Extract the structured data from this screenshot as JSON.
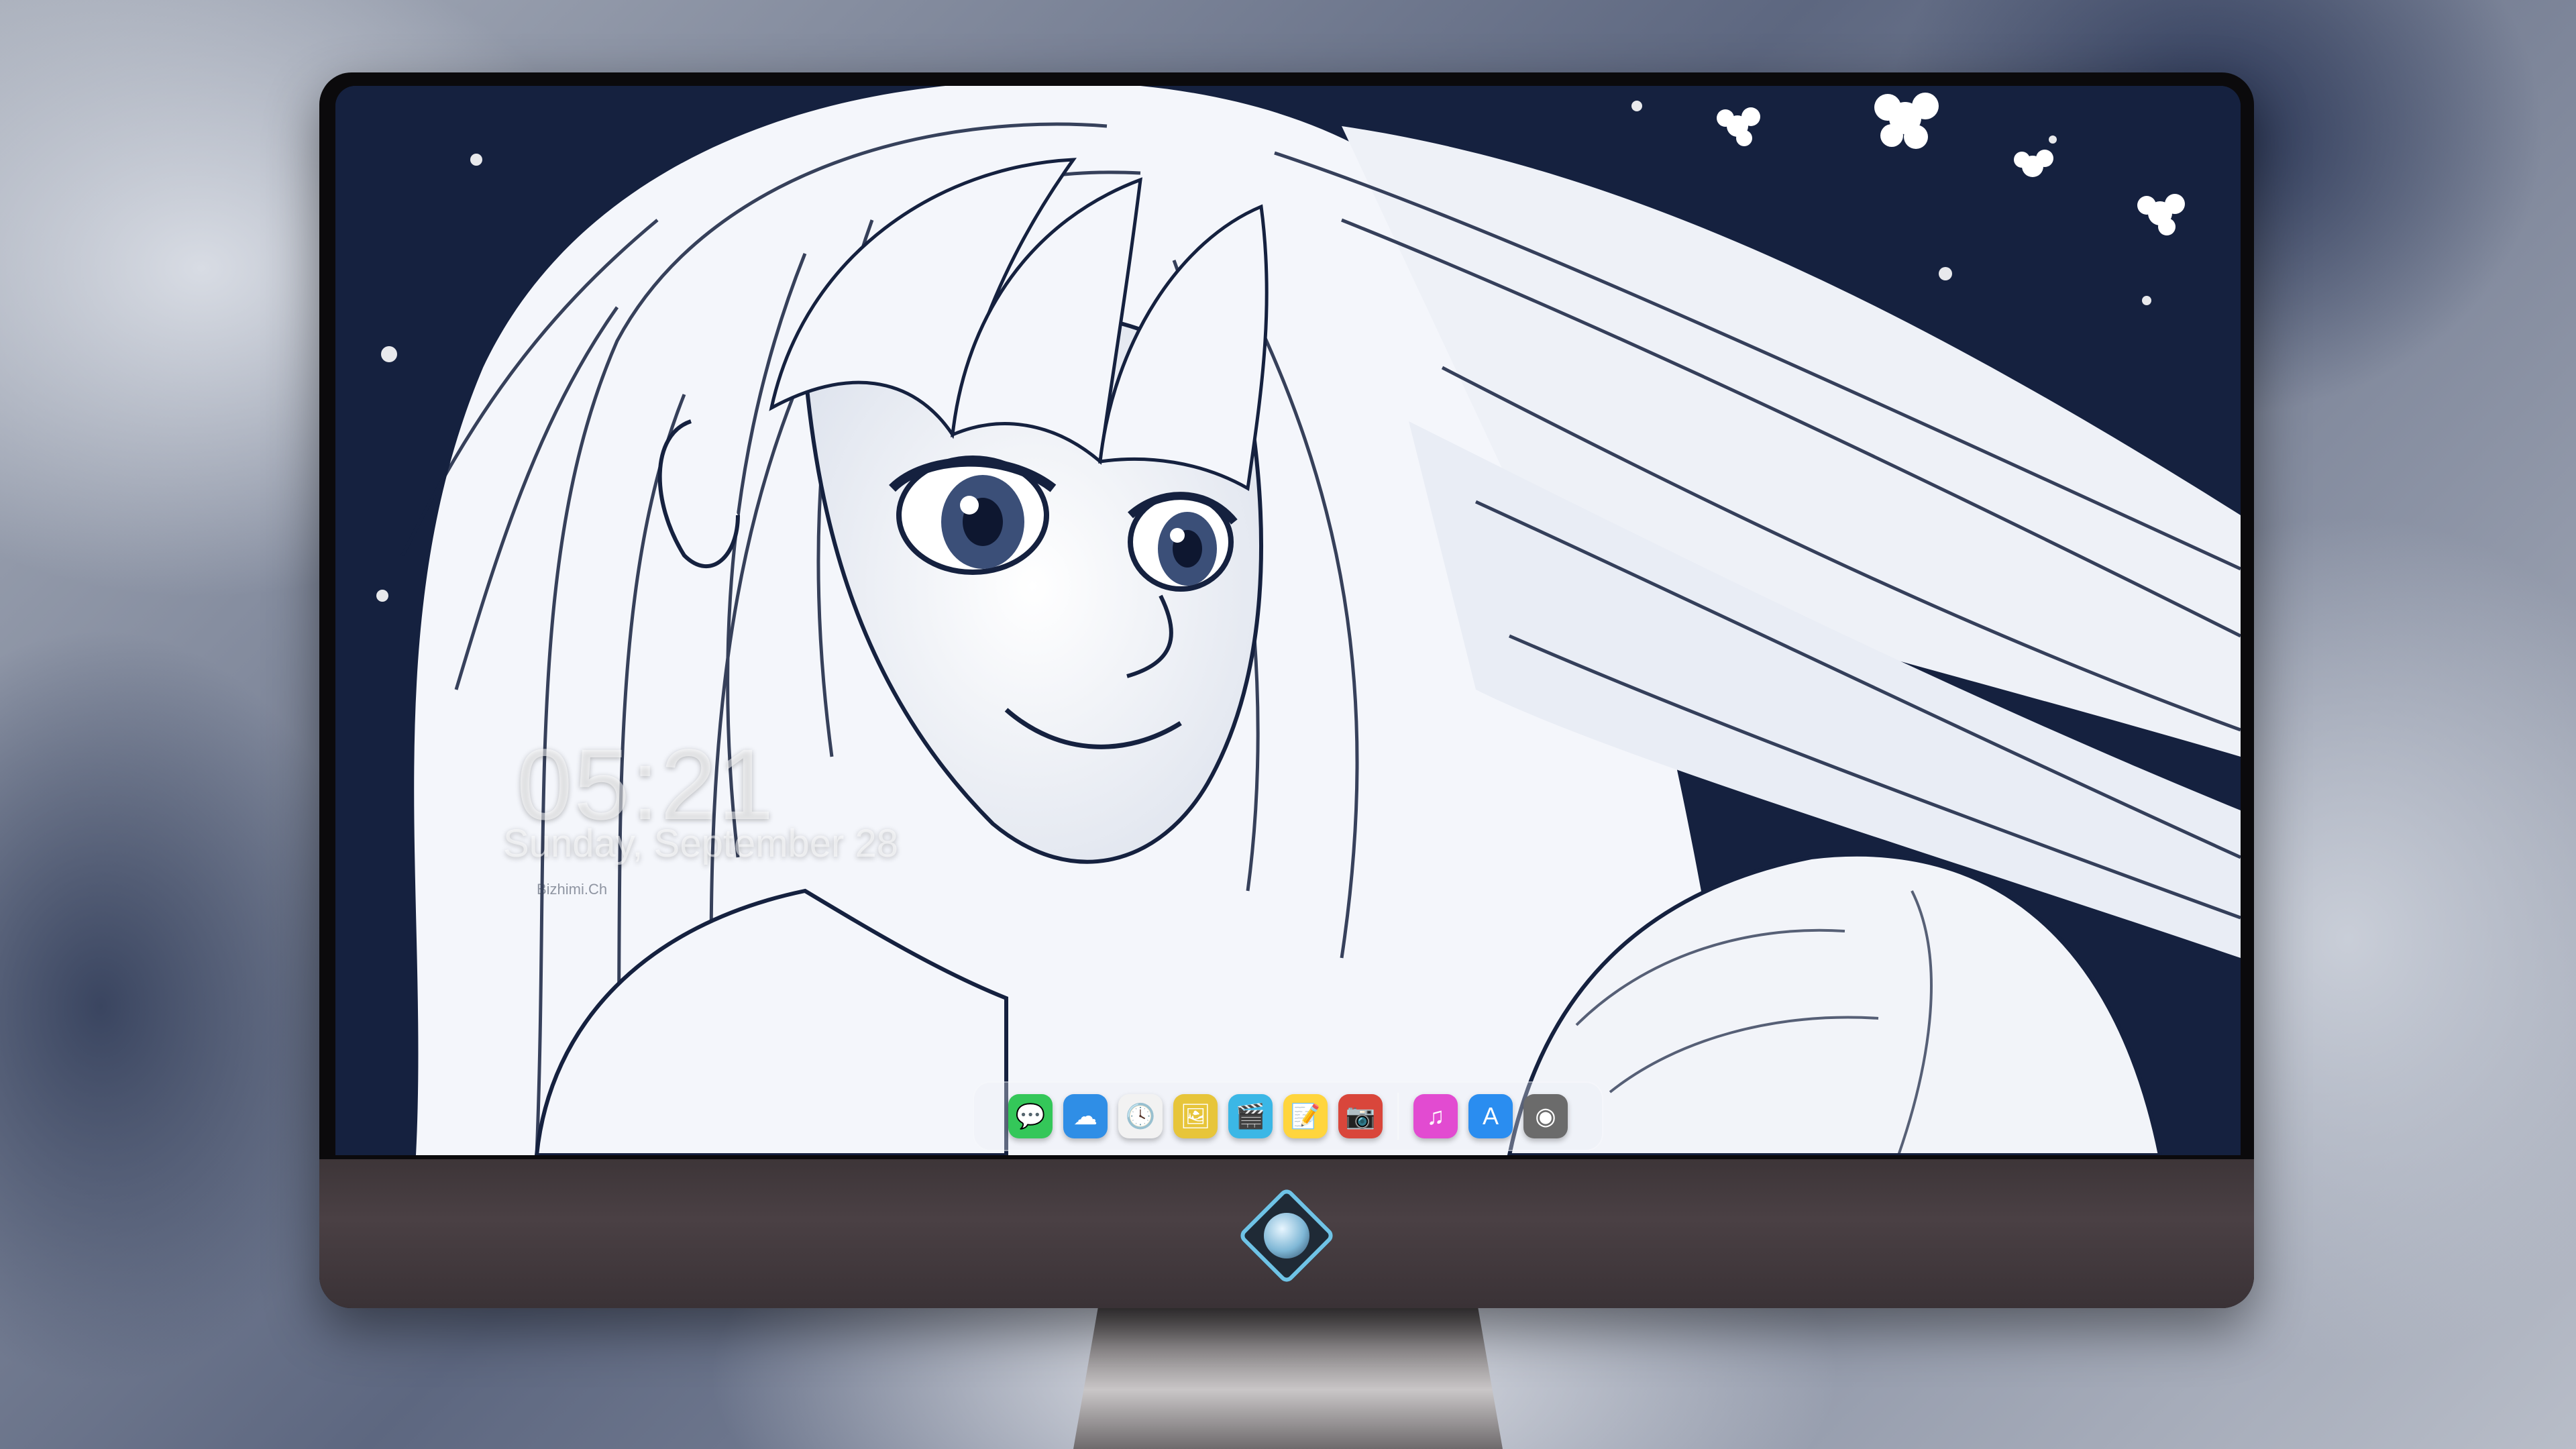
{
  "lockscreen": {
    "time": "05:21",
    "date": "Sunday, September 28",
    "watermark": "Bizhimi.Ch"
  },
  "dock": {
    "apps": [
      {
        "name": "messages-icon",
        "color": "#34c759",
        "glyph": "💬"
      },
      {
        "name": "weather-icon",
        "color": "#2f8ee6",
        "glyph": "☁"
      },
      {
        "name": "clock-icon",
        "color": "#f2f2f2",
        "glyph": "🕓"
      },
      {
        "name": "preview-icon",
        "color": "#e7c53a",
        "glyph": "🖼"
      },
      {
        "name": "clips-icon",
        "color": "#3bb7e6",
        "glyph": "🎬"
      },
      {
        "name": "notes-icon",
        "color": "#ffd53d",
        "glyph": "📝"
      },
      {
        "name": "photo-booth-icon",
        "color": "#d9463b",
        "glyph": "📷"
      },
      {
        "name": "music-icon",
        "color": "#e24bd1",
        "glyph": "♫"
      },
      {
        "name": "app-store-icon",
        "color": "#2a8df0",
        "glyph": "A"
      },
      {
        "name": "camera-icon",
        "color": "#6b6b6b",
        "glyph": "◉"
      }
    ]
  },
  "colors": {
    "wallpaper_ink": "#15213f",
    "bezel": "#0b0a0c",
    "chin": "#4a4044"
  }
}
